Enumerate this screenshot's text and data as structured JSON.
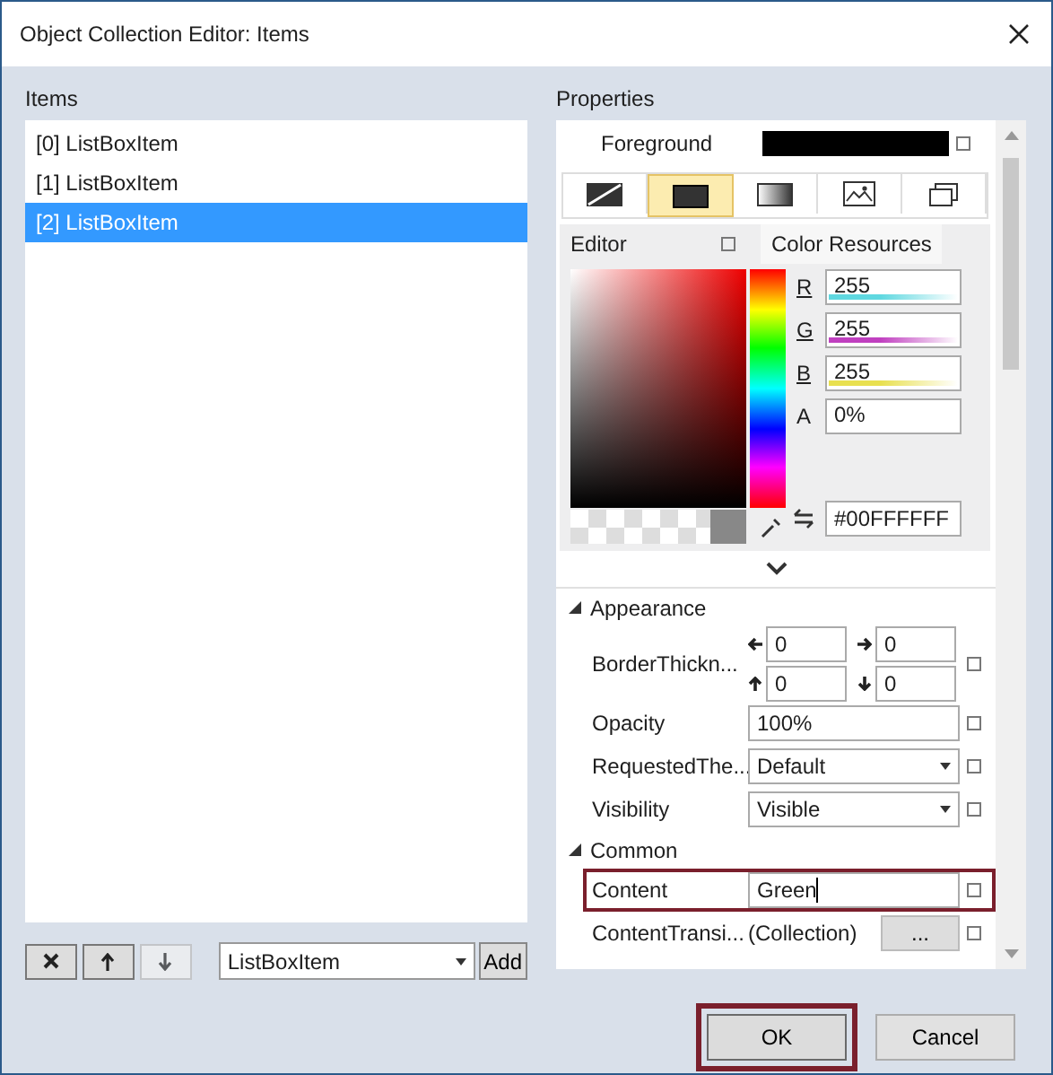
{
  "window": {
    "title": "Object Collection Editor: Items"
  },
  "items": {
    "label": "Items",
    "list": [
      {
        "label": "[0] ListBoxItem",
        "selected": false
      },
      {
        "label": "[1] ListBoxItem",
        "selected": false
      },
      {
        "label": "[2] ListBoxItem",
        "selected": true
      }
    ]
  },
  "item_toolbar": {
    "buttons": [
      {
        "kind": "remove",
        "disabled": false
      },
      {
        "kind": "up",
        "disabled": false
      },
      {
        "kind": "down",
        "disabled": true
      }
    ],
    "type_dropdown": "ListBoxItem",
    "add_button": "Add"
  },
  "properties": {
    "label": "Properties",
    "foreground": {
      "label": "Foreground",
      "color": "#000000"
    },
    "brush_tabs": [
      {
        "kind": "none",
        "selected": false
      },
      {
        "kind": "solid",
        "selected": true
      },
      {
        "kind": "gradient",
        "selected": false
      },
      {
        "kind": "image",
        "selected": false
      },
      {
        "kind": "resource",
        "selected": false
      }
    ],
    "editor": {
      "tabs": [
        {
          "label": "Editor",
          "selected": true
        },
        {
          "label": "Color Resources",
          "selected": false
        }
      ],
      "channels": [
        {
          "label": "R",
          "value": "255",
          "color": "#5fd8e0"
        },
        {
          "label": "G",
          "value": "255",
          "color": "#c040c0"
        },
        {
          "label": "B",
          "value": "255",
          "color": "#e8e050"
        },
        {
          "label": "A",
          "value": "0%"
        }
      ],
      "hex": "#00FFFFFF"
    },
    "categories": [
      {
        "label": "Appearance",
        "expanded": true,
        "properties": [
          {
            "kind": "thickness",
            "name": "BorderThickn...",
            "values": [
              "0",
              "0",
              "0",
              "0"
            ]
          },
          {
            "kind": "text",
            "name": "Opacity",
            "value": "100%",
            "highlighted": false
          },
          {
            "kind": "dropdown",
            "name": "RequestedThe...",
            "value": "Default"
          },
          {
            "kind": "dropdown",
            "name": "Visibility",
            "value": "Visible"
          }
        ]
      },
      {
        "label": "Common",
        "expanded": true,
        "properties": [
          {
            "kind": "text",
            "name": "Content",
            "value": "Green",
            "highlighted": true
          },
          {
            "kind": "collection",
            "name": "ContentTransi...",
            "value": "(Collection)",
            "button": "..."
          }
        ]
      }
    ]
  },
  "buttons": [
    {
      "label": "OK",
      "highlighted": true
    },
    {
      "label": "Cancel",
      "highlighted": false
    }
  ]
}
